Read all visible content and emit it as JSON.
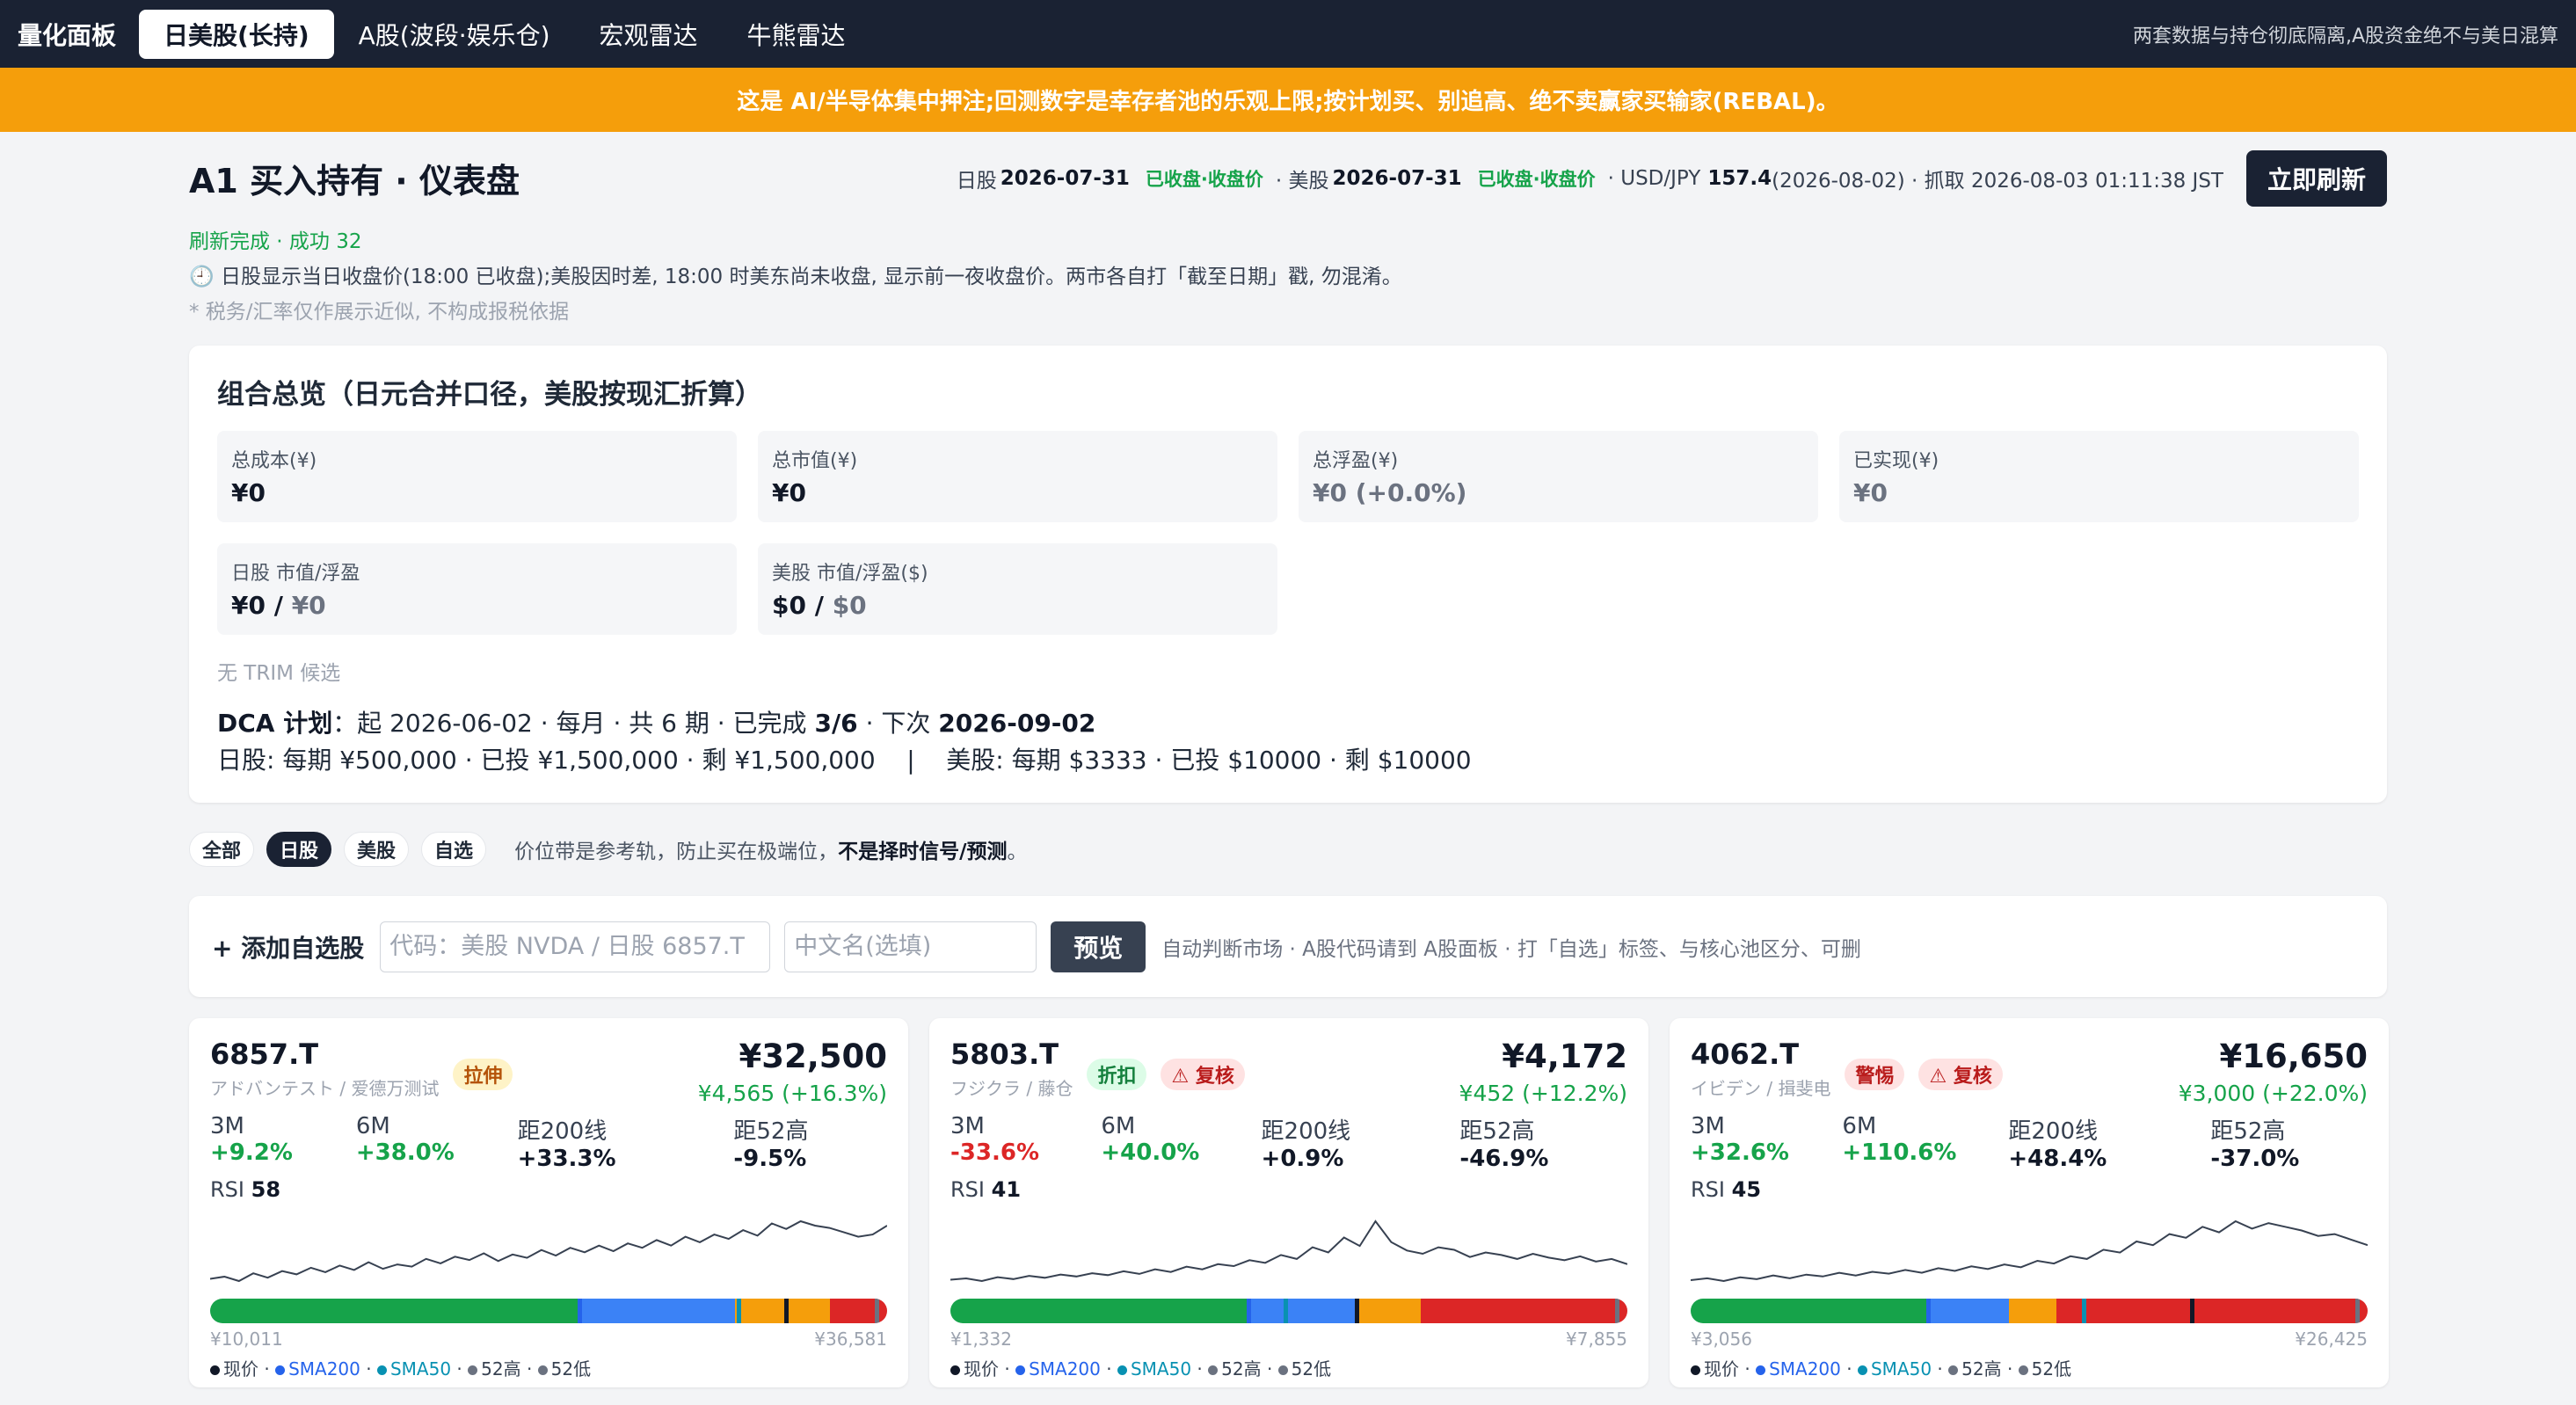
{
  "nav": {
    "brand": "量化面板",
    "tabs": [
      "日美股(长持)",
      "A股(波段·娱乐仓)",
      "宏观雷达",
      "牛熊雷达"
    ],
    "note": "两套数据与持仓彻底隔离,A股资金绝不与美日混算"
  },
  "banner": "这是 AI/半导体集中押注;回测数字是幸存者池的乐观上限;按计划买、别追高、绝不卖赢家买输家(REBAL)。",
  "header": {
    "title": "A1 买入持有 · 仪表盘",
    "jp_label": "日股",
    "jp_date": "2026-07-31",
    "jp_status": "已收盘·收盘价",
    "us_label": "· 美股",
    "us_date": "2026-07-31",
    "us_status": "已收盘·收盘价",
    "fx_label": "· USD/JPY",
    "fx_value": "157.4",
    "fx_tail": "(2026-08-02) · 抓取 2026-08-03 01:11:38 JST",
    "refresh": "立即刷新"
  },
  "info": {
    "status": "刷新完成 · 成功 32",
    "note": "🕘 日股显示当日收盘价(18:00 已收盘);美股因时差, 18:00 时美东尚未收盘, 显示前一夜收盘价。两市各自打「截至日期」戳, 勿混淆。",
    "disclaimer": "* 税务/汇率仅作展示近似, 不构成报税依据"
  },
  "overview": {
    "title": "组合总览（日元合并口径，美股按现汇折算）",
    "cells": [
      {
        "label": "总成本(¥)",
        "value": "¥0"
      },
      {
        "label": "总市值(¥)",
        "value": "¥0"
      },
      {
        "label": "总浮盈(¥)",
        "value": "¥0 (+0.0%)"
      },
      {
        "label": "已实现(¥)",
        "value": "¥0"
      }
    ],
    "jp": {
      "label": "日股 市值/浮盈",
      "v1": "¥0 /",
      "v2": "¥0"
    },
    "us": {
      "label": "美股 市值/浮盈($)",
      "v1": "$0 /",
      "v2": "$0"
    },
    "no_trim": "无 TRIM 候选",
    "dca_label": "DCA 计划",
    "dca_a": "：起 2026-06-02 · 每月 · 共 6 期 · 已完成",
    "dca_done": "3/6",
    "dca_b": " · 下次",
    "dca_next": "2026-09-02",
    "dca_line2": "日股: 每期 ¥500,000 · 已投 ¥1,500,000 · 剩 ¥1,500,000    |    美股: 每期 $3333 · 已投 $10000 · 剩 $10000"
  },
  "filters": {
    "chips": [
      "全部",
      "日股",
      "美股",
      "自选"
    ],
    "note_a": "价位带是参考轨，防止买在极端位，",
    "note_b": "不是择时信号/预测",
    "note_c": "。"
  },
  "add": {
    "label": "+ 添加自选股",
    "code_placeholder": "代码：美股 NVDA / 日股 6857.T",
    "name_placeholder": "中文名(选填)",
    "preview": "预览",
    "note": "自动判断市场 · A股代码请到 A股面板 · 打「自选」标签、与核心池区分、可删"
  },
  "legend": {
    "now": "现价",
    "sma200": "SMA200",
    "sma50": "SMA50",
    "hi": "52高",
    "lo": "52低",
    "sep": " · "
  },
  "colors": {
    "green": "#16a34a",
    "blue": "#3b82f6",
    "orange": "#f59e0b",
    "red": "#dc2626",
    "sma200": "#2563eb",
    "sma50": "#0891b2"
  },
  "stocks": [
    {
      "code": "6857.T",
      "name": "アドバンテスト / 爱德万测试",
      "badges": [
        {
          "text": "拉伸",
          "tone": "yellow"
        }
      ],
      "price": "¥32,500",
      "pnl": "¥4,565 (+16.3%)",
      "m3": "+9.2%",
      "m6": "+38.0%",
      "d200": "+33.3%",
      "d52": "-9.5%",
      "rsi": "58",
      "lo": "¥10,011",
      "hi": "¥36,581",
      "bands": [
        0.545,
        0.23,
        0.14,
        0.085
      ],
      "marks": [
        0.545,
        0.78,
        0.85,
        0.985
      ],
      "spark": [
        40,
        42,
        38,
        45,
        41,
        47,
        44,
        50,
        46,
        52,
        48,
        55,
        49,
        53,
        51,
        58,
        54,
        60,
        57,
        63,
        56,
        62,
        59,
        66,
        61,
        68,
        64,
        70,
        65,
        72,
        68,
        75,
        70,
        78,
        73,
        80,
        76,
        84,
        79,
        90,
        85,
        92,
        88,
        86,
        82,
        78,
        80,
        88
      ]
    },
    {
      "code": "5803.T",
      "name": "フジクラ / 藤仓",
      "badges": [
        {
          "text": "折扣",
          "tone": "green"
        },
        {
          "text": "⚠ 复核",
          "tone": "red"
        }
      ],
      "price": "¥4,172",
      "pnl": "¥452 (+12.2%)",
      "m3": "-33.6%",
      "m6": "+40.0%",
      "d200": "+0.9%",
      "d52": "-46.9%",
      "rsi": "41",
      "lo": "¥1,332",
      "hi": "¥7,855",
      "bands": [
        0.44,
        0.16,
        0.095,
        0.305
      ],
      "marks": [
        0.44,
        0.495,
        0.6,
        0.985
      ],
      "spark": [
        20,
        22,
        18,
        24,
        21,
        26,
        23,
        28,
        25,
        30,
        27,
        33,
        29,
        36,
        32,
        40,
        36,
        44,
        41,
        50,
        46,
        58,
        52,
        70,
        62,
        85,
        72,
        110,
        78,
        65,
        60,
        70,
        66,
        55,
        62,
        58,
        52,
        60,
        54,
        50,
        56,
        48,
        52,
        44
      ]
    },
    {
      "code": "4062.T",
      "name": "イビデン / 揖斐电",
      "badges": [
        {
          "text": "警惕",
          "tone": "red"
        },
        {
          "text": "⚠ 复核",
          "tone": "red"
        }
      ],
      "price": "¥16,650",
      "pnl": "¥3,000 (+22.0%)",
      "m3": "+32.6%",
      "m6": "+110.6%",
      "d200": "+48.4%",
      "d52": "-37.0%",
      "rsi": "45",
      "lo": "¥3,056",
      "hi": "¥26,425",
      "bands": [
        0.35,
        0.12,
        0.07,
        0.46
      ],
      "marks": [
        0.35,
        0.58,
        0.74,
        0.985
      ],
      "spark": [
        22,
        24,
        21,
        25,
        23,
        27,
        24,
        28,
        26,
        30,
        27,
        31,
        29,
        33,
        30,
        35,
        32,
        37,
        34,
        39,
        36,
        43,
        40,
        48,
        45,
        55,
        52,
        64,
        60,
        72,
        68,
        80,
        74,
        86,
        78,
        84,
        80,
        76,
        70,
        72,
        66,
        60
      ]
    }
  ]
}
